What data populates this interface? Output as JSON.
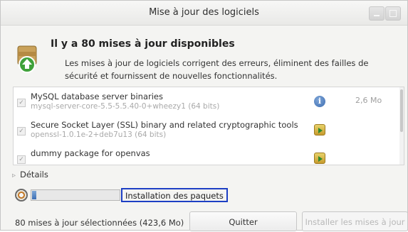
{
  "window": {
    "title": "Mise à jour des logiciels"
  },
  "header": {
    "title": "Il y a 80 mises à jour disponibles",
    "description": "Les mises à jour de logiciels corrigent des erreurs, éliminent des failles de sécurité et fournissent de nouvelles fonctionnalités."
  },
  "updates": [
    {
      "name": "MySQL database server binaries",
      "version": "mysql-server-core-5.5-5.5.40-0+wheezy1 (64 bits)",
      "icon": "info-icon",
      "size": "2,6 Mo"
    },
    {
      "name": "Secure Socket Layer (SSL) binary and related cryptographic tools",
      "version": "openssl-1.0.1e-2+deb7u13 (64 bits)",
      "icon": "package-upgrade-icon",
      "size": ""
    },
    {
      "name": "dummy package for openvas",
      "version": "",
      "icon": "package-upgrade-icon",
      "size": ""
    }
  ],
  "details": {
    "label": "Détails"
  },
  "progress": {
    "fraction": 0.05,
    "status": "Installation des paquets"
  },
  "footer": {
    "selected_text": "80 mises à jour sélectionnées (423,6 Mo)",
    "quit_label": "Quitter",
    "install_label": "Installer les mises à jour"
  },
  "colors": {
    "status_highlight": "#1d3fc4",
    "progress_fill": "#3d6fb5"
  }
}
